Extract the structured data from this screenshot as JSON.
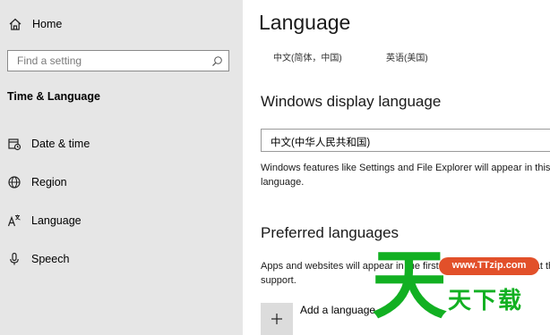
{
  "sidebar": {
    "home_label": "Home",
    "search_placeholder": "Find a setting",
    "section_heading": "Time & Language",
    "items": [
      {
        "label": "Date & time",
        "icon": "calendar-clock-icon"
      },
      {
        "label": "Region",
        "icon": "globe-icon"
      },
      {
        "label": "Language",
        "icon": "language-icon"
      },
      {
        "label": "Speech",
        "icon": "microphone-icon"
      }
    ]
  },
  "main": {
    "title": "Language",
    "lang_tiles": [
      "中文(简体，中国)",
      "英语(美国)"
    ],
    "display_language": {
      "heading": "Windows display language",
      "selected": "中文(中华人民共和国)",
      "description": "Windows features like Settings and File Explorer will appear in this language."
    },
    "preferred": {
      "heading": "Preferred languages",
      "description": "Apps and websites will appear in the first language in the list that they support.",
      "add_label": "Add a language"
    }
  },
  "watermark": {
    "big_char": "天",
    "url": "www.TTzip.com",
    "text": "天下载"
  },
  "colors": {
    "sidebar_bg": "#e6e6e6",
    "watermark_green": "#12b022",
    "watermark_orange": "#e2502a"
  }
}
